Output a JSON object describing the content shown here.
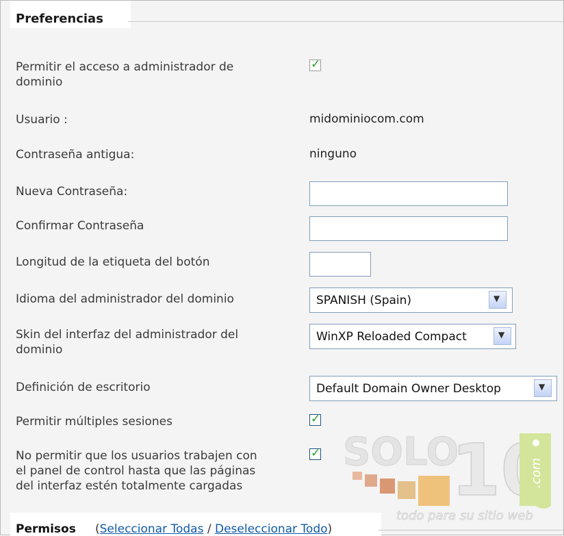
{
  "section": {
    "title": "Preferencias"
  },
  "rows": {
    "allow_access": {
      "label_l1": "Permitir el acceso a administrador de",
      "label_l2": "dominio",
      "checked": true
    },
    "user": {
      "label": "Usuario :",
      "value": "midominiocom.com"
    },
    "old_password": {
      "label": "Contraseña antigua:",
      "value": "ninguno"
    },
    "new_password": {
      "label": "Nueva Contraseña:",
      "value": ""
    },
    "confirm_password": {
      "label": "Confirmar Contraseña",
      "value": ""
    },
    "button_label_length": {
      "label": "Longitud de la etiqueta del botón",
      "value": ""
    },
    "language": {
      "label": "Idioma del administrador del dominio",
      "selected": "SPANISH (Spain)"
    },
    "skin": {
      "label_l1": "Skin del interfaz del administrador del",
      "label_l2": "dominio",
      "selected": "WinXP Reloaded Compact"
    },
    "desktop": {
      "label": "Definición de escritorio",
      "selected": "Default Domain Owner Desktop"
    },
    "multiple_sessions": {
      "label": "Permitir múltiples sesiones",
      "checked": true
    },
    "page_load": {
      "label_l1": "No permitir que los usuarios trabajen con",
      "label_l2": "el panel de control hasta que las páginas",
      "label_l3": "del interfaz estén totalmente cargadas",
      "checked": true
    }
  },
  "permissions": {
    "title": "Permisos",
    "open_paren": "(",
    "select_all": "Seleccionar Todas",
    "separator": " / ",
    "deselect_all": "Deseleccionar Todo",
    "close_paren": ")"
  },
  "watermark": {
    "brand_text": "SOLO10",
    "dot_com": ".com",
    "tagline": "todo para su sitio web"
  },
  "colors": {
    "checkmark": "#21a121",
    "link": "#0f5aa8",
    "panel_bg": "#f4f4f4"
  }
}
